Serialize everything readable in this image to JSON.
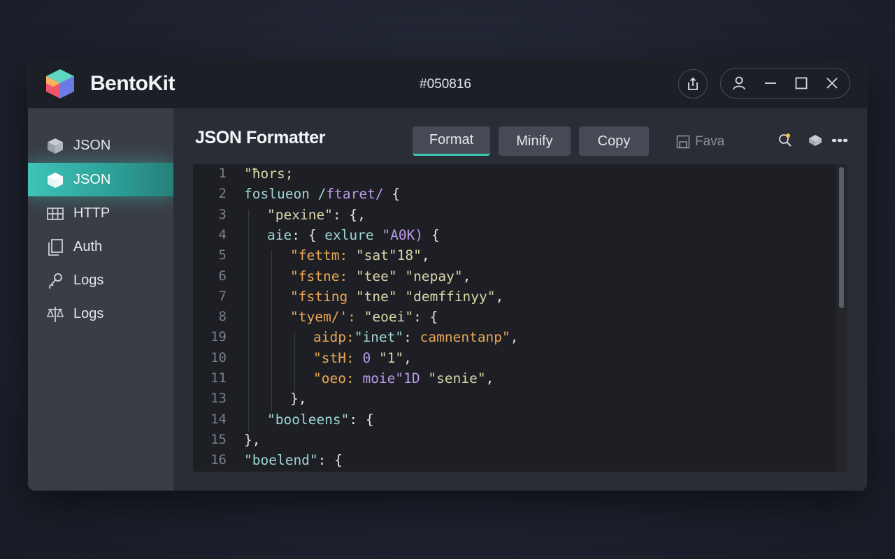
{
  "app": {
    "name": "BentoKit",
    "window_id": "#050816",
    "accent_color": "#3ec4b4"
  },
  "titlebar": {
    "share_icon": "share-icon",
    "controls": [
      "user-icon",
      "minimize-icon",
      "maximize-icon",
      "close-icon"
    ]
  },
  "sidebar": {
    "items": [
      {
        "label": "JSON",
        "icon": "cube-icon",
        "active": false
      },
      {
        "label": "JSON",
        "icon": "cube-icon",
        "active": true
      },
      {
        "label": "HTTP",
        "icon": "grid-icon",
        "active": false
      },
      {
        "label": "Auth",
        "icon": "copy-icon",
        "active": false
      },
      {
        "label": "Logs",
        "icon": "key-icon",
        "active": false
      },
      {
        "label": "Logs",
        "icon": "balance-icon",
        "active": false
      }
    ]
  },
  "main": {
    "title": "JSON Formatter",
    "buttons": {
      "format": "Format",
      "minify": "Minify",
      "copy": "Copy",
      "save": "Fava"
    },
    "tools": [
      "search-icon",
      "tag-icon",
      "more-icon",
      "overflow-icon"
    ]
  },
  "editor": {
    "lines": [
      {
        "num": "1",
        "indent": 0,
        "tokens": [
          {
            "t": "\"ħors;",
            "c": "str"
          }
        ]
      },
      {
        "num": "2",
        "indent": 0,
        "tokens": [
          {
            "t": "foslueon /",
            "c": "key"
          },
          {
            "t": "ftaret/",
            "c": "val"
          },
          {
            "t": " {",
            "c": "pun"
          }
        ]
      },
      {
        "num": "3",
        "indent": 1,
        "tokens": [
          {
            "t": "\"pexine\"",
            "c": "str"
          },
          {
            "t": ": {,",
            "c": "pun"
          }
        ]
      },
      {
        "num": "4",
        "indent": 1,
        "tokens": [
          {
            "t": "aie",
            "c": "key"
          },
          {
            "t": ": { ",
            "c": "pun"
          },
          {
            "t": "exlure ",
            "c": "key"
          },
          {
            "t": "\"A0K)",
            "c": "val"
          },
          {
            "t": " {",
            "c": "pun"
          }
        ]
      },
      {
        "num": "5",
        "indent": 2,
        "tokens": [
          {
            "t": "\"fettm: ",
            "c": "num"
          },
          {
            "t": "\"sat\"18\"",
            "c": "str"
          },
          {
            "t": ",",
            "c": "pun"
          }
        ]
      },
      {
        "num": "6",
        "indent": 2,
        "tokens": [
          {
            "t": "\"fstne: ",
            "c": "num"
          },
          {
            "t": "\"tee\" ",
            "c": "str"
          },
          {
            "t": "\"nepay\"",
            "c": "str"
          },
          {
            "t": ",",
            "c": "pun"
          }
        ]
      },
      {
        "num": "7",
        "indent": 2,
        "tokens": [
          {
            "t": "\"fsting ",
            "c": "num"
          },
          {
            "t": "\"tne\" ",
            "c": "str"
          },
          {
            "t": "\"demffinyy\"",
            "c": "str"
          },
          {
            "t": ",",
            "c": "pun"
          }
        ]
      },
      {
        "num": "8",
        "indent": 2,
        "tokens": [
          {
            "t": "\"tyem/': ",
            "c": "num"
          },
          {
            "t": "\"eoei\"",
            "c": "str"
          },
          {
            "t": ": {",
            "c": "pun"
          }
        ]
      },
      {
        "num": "19",
        "indent": 3,
        "tokens": [
          {
            "t": "aidp:",
            "c": "num"
          },
          {
            "t": "\"inet\"",
            "c": "key"
          },
          {
            "t": ": ",
            "c": "pun"
          },
          {
            "t": "camnentanp\"",
            "c": "num"
          },
          {
            "t": ",",
            "c": "pun"
          }
        ]
      },
      {
        "num": "10",
        "indent": 3,
        "tokens": [
          {
            "t": "\"stH: ",
            "c": "num"
          },
          {
            "t": "0 ",
            "c": "val"
          },
          {
            "t": "\"1\"",
            "c": "str"
          },
          {
            "t": ",",
            "c": "pun"
          }
        ]
      },
      {
        "num": "11",
        "indent": 3,
        "tokens": [
          {
            "t": "\"oeo: ",
            "c": "num"
          },
          {
            "t": "moie\"1D ",
            "c": "val"
          },
          {
            "t": "\"senie\"",
            "c": "str"
          },
          {
            "t": ",",
            "c": "pun"
          }
        ]
      },
      {
        "num": "13",
        "indent": 2,
        "tokens": [
          {
            "t": "},",
            "c": "pun"
          }
        ]
      },
      {
        "num": "14",
        "indent": 1,
        "tokens": [
          {
            "t": "\"booleens\"",
            "c": "key"
          },
          {
            "t": ": {",
            "c": "pun"
          }
        ]
      },
      {
        "num": "15",
        "indent": 0,
        "tokens": [
          {
            "t": "},",
            "c": "pun"
          }
        ]
      },
      {
        "num": "16",
        "indent": 0,
        "tokens": [
          {
            "t": "\"boelend\"",
            "c": "key"
          },
          {
            "t": ": {",
            "c": "pun"
          }
        ]
      }
    ]
  }
}
